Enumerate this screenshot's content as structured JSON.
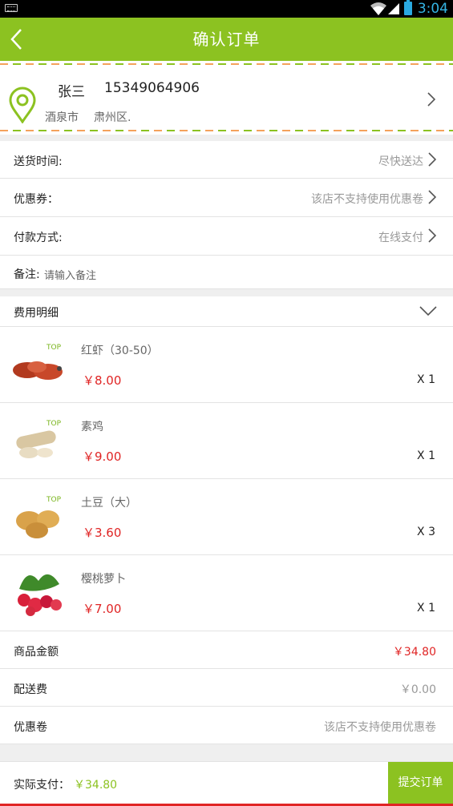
{
  "statusbar": {
    "time": "3:04"
  },
  "header": {
    "title": "确认订单"
  },
  "address": {
    "name": "张三",
    "phone": "15349064906",
    "city": "酒泉市",
    "district": "肃州区."
  },
  "options": [
    {
      "label": "送货时间:",
      "value": "尽快送达"
    },
    {
      "label": "优惠券：",
      "value": "该店不支持使用优惠卷"
    },
    {
      "label": "付款方式:",
      "value": "在线支付"
    }
  ],
  "note": {
    "label": "备注:",
    "placeholder": "请输入备注"
  },
  "fee_details": {
    "label": "费用明细"
  },
  "items": [
    {
      "name": "红虾（30-50）",
      "price": "￥8.00",
      "qty": "X 1",
      "icon": "shrimp-image"
    },
    {
      "name": "素鸡",
      "price": "￥9.00",
      "qty": "X 1",
      "icon": "tofu-roll-image"
    },
    {
      "name": "土豆（大）",
      "price": "￥3.60",
      "qty": "X 3",
      "icon": "potato-image"
    },
    {
      "name": "樱桃萝卜",
      "price": "￥7.00",
      "qty": "X 1",
      "icon": "radish-image"
    }
  ],
  "summary": [
    {
      "label": "商品金额",
      "value": "￥34.80"
    },
    {
      "label": "配送费",
      "value": "￥0.00"
    },
    {
      "label": "优惠卷",
      "value": "该店不支持使用优惠卷"
    }
  ],
  "footer": {
    "label": "实际支付：",
    "amount": "￥34.80",
    "submit": "提交订单"
  },
  "colors": {
    "brand": "#8cc221",
    "price": "#e02525",
    "muted": "#999999"
  }
}
